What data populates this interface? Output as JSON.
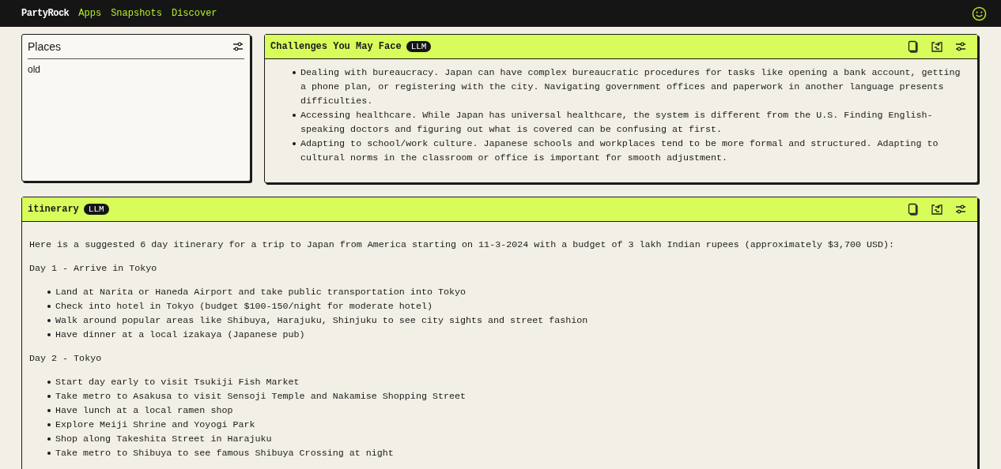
{
  "nav": {
    "brand": "PartyRock",
    "links": [
      "Apps",
      "Snapshots",
      "Discover"
    ]
  },
  "widgets": [
    {
      "kind": "input",
      "title": "Places",
      "value": "old"
    },
    {
      "kind": "llm",
      "title": "Challenges You May Face",
      "badge": "LLM",
      "blocks": [
        {
          "kind": "list",
          "items": [
            "Dealing with bureaucracy. Japan can have complex bureaucratic procedures for tasks like opening a bank account, getting a phone plan, or registering with the city. Navigating government offices and paperwork in another language presents difficulties.",
            "Accessing healthcare. While Japan has universal healthcare, the system is different from the U.S. Finding English-speaking doctors and figuring out what is covered can be confusing at first.",
            "Adapting to school/work culture. Japanese schools and workplaces tend to be more formal and structured. Adapting to cultural norms in the classroom or office is important for smooth adjustment."
          ]
        }
      ]
    },
    {
      "kind": "llm",
      "title": "itinerary",
      "badge": "LLM",
      "blocks": [
        {
          "kind": "para",
          "text": "Here is a suggested 6 day itinerary for a trip to Japan from America starting on 11-3-2024 with a budget of 3 lakh Indian rupees (approximately $3,700 USD):"
        },
        {
          "kind": "para",
          "text": "Day 1 - Arrive in Tokyo"
        },
        {
          "kind": "list",
          "items": [
            "Land at Narita or Haneda Airport and take public transportation into Tokyo",
            "Check into hotel in Tokyo (budget $100-150/night for moderate hotel)",
            "Walk around popular areas like Shibuya, Harajuku, Shinjuku to see city sights and street fashion",
            "Have dinner at a local izakaya (Japanese pub)"
          ]
        },
        {
          "kind": "para",
          "text": "Day 2 - Tokyo"
        },
        {
          "kind": "list",
          "items": [
            "Start day early to visit Tsukiji Fish Market",
            "Take metro to Asakusa to visit Sensoji Temple and Nakamise Shopping Street",
            "Have lunch at a local ramen shop",
            "Explore Meiji Shrine and Yoyogi Park",
            "Shop along Takeshita Street in Harajuku",
            "Take metro to Shibuya to see famous Shibuya Crossing at night"
          ]
        }
      ]
    }
  ]
}
